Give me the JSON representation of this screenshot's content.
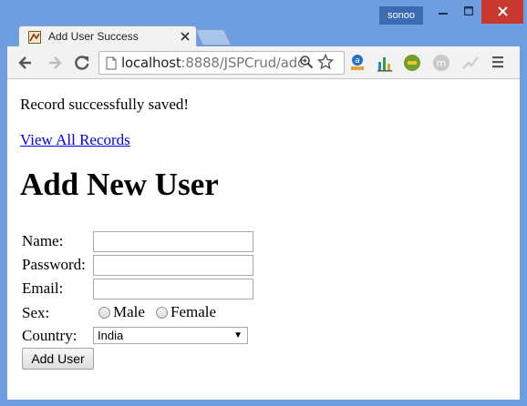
{
  "browser": {
    "profile_name": "sonoo",
    "tab_title": "Add User Success",
    "url_host": "localhost",
    "url_path": ":8888/JSPCrud/adc"
  },
  "page": {
    "message": "Record successfully saved!",
    "view_all_link": "View All Records",
    "heading": "Add New User",
    "form": {
      "name_label": "Name:",
      "name_value": "",
      "password_label": "Password:",
      "password_value": "",
      "email_label": "Email:",
      "email_value": "",
      "sex_label": "Sex:",
      "sex_options": [
        "Male",
        "Female"
      ],
      "country_label": "Country:",
      "country_selected": "India",
      "submit_label": "Add User"
    }
  },
  "colors": {
    "window_frame": "#6f9ee0",
    "close_button": "#c8382e",
    "link": "#0000ee"
  },
  "icons": [
    "back-icon",
    "forward-icon",
    "reload-icon",
    "page-icon",
    "zoom-icon",
    "star-icon",
    "menu-icon"
  ]
}
